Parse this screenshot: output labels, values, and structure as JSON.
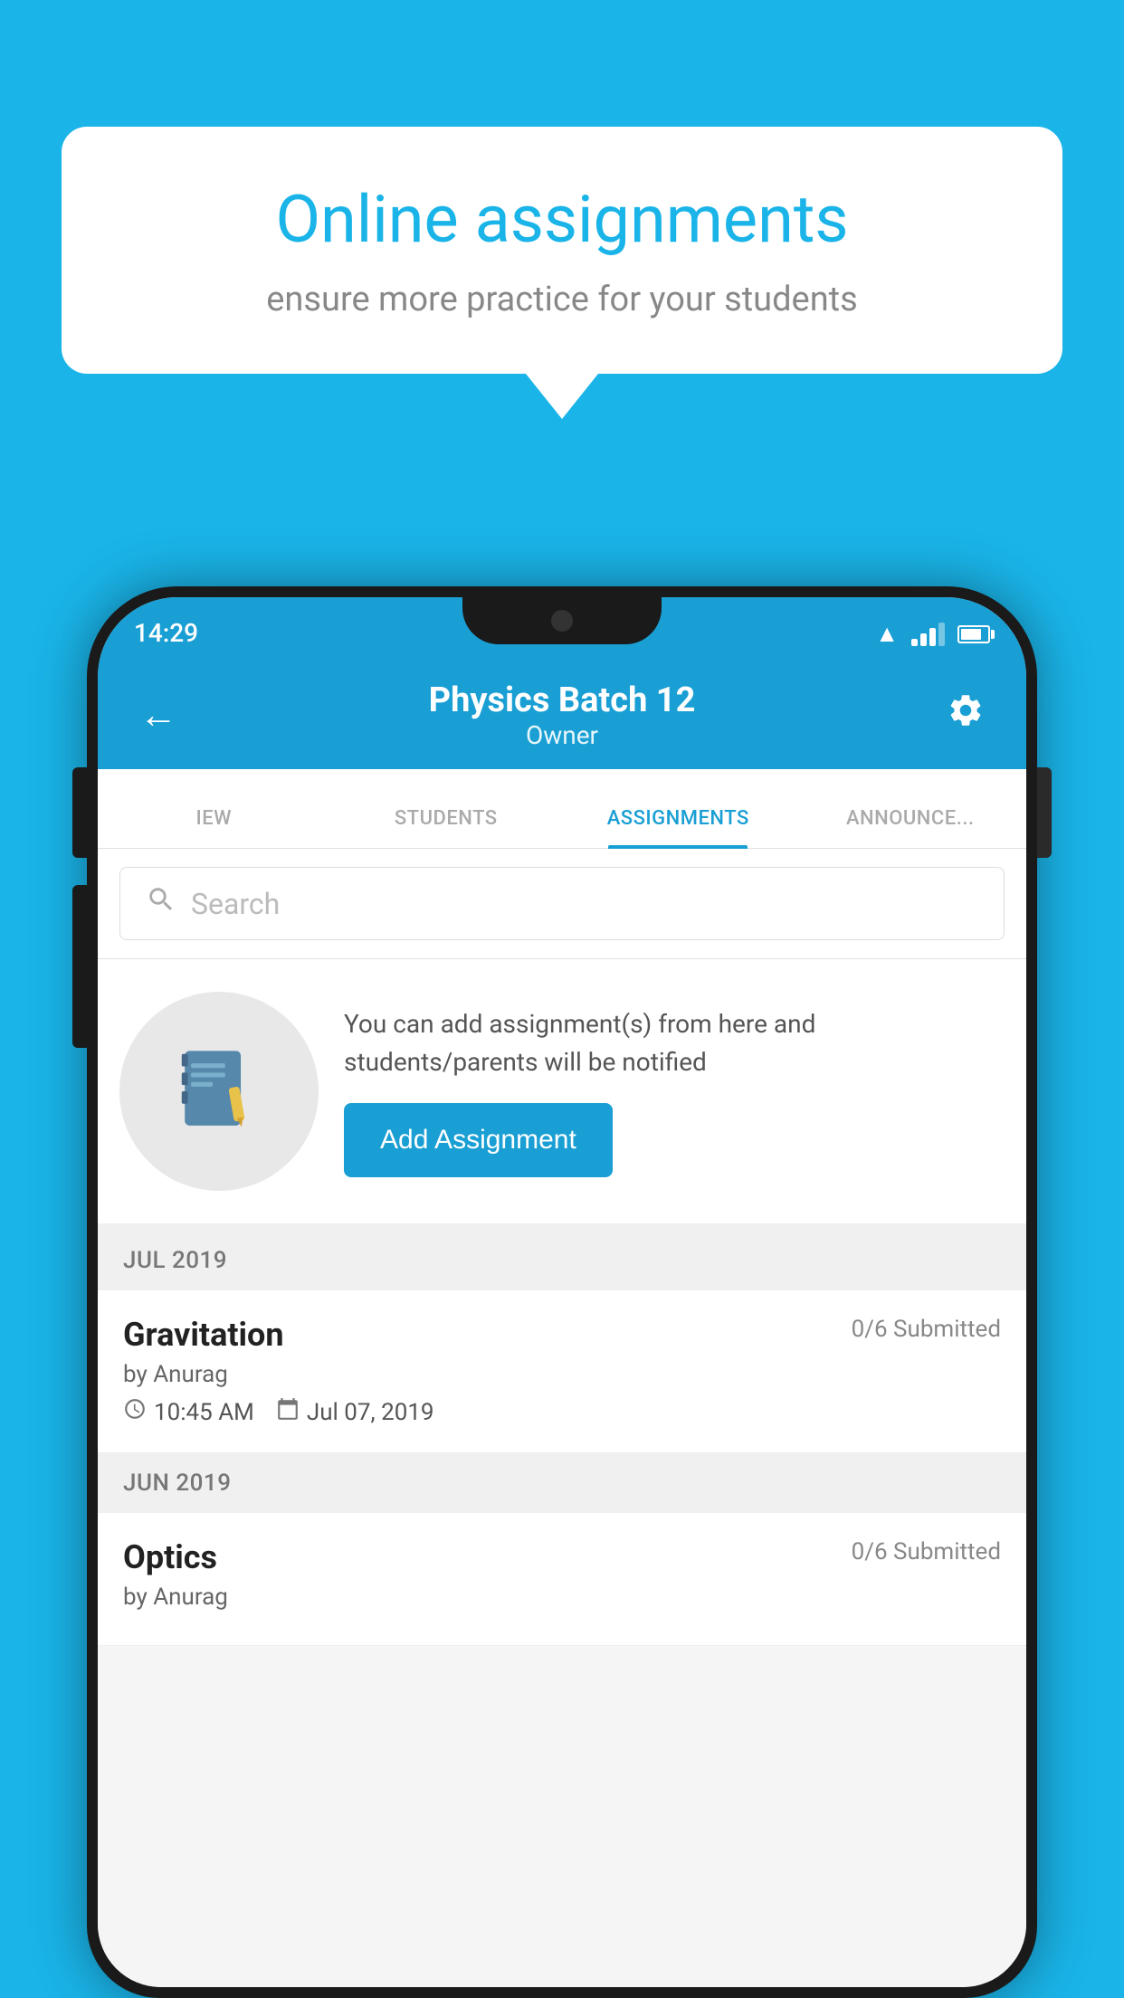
{
  "background_color": "#1ab4e8",
  "speech_bubble": {
    "title": "Online assignments",
    "subtitle": "ensure more practice for your students"
  },
  "phone": {
    "status_bar": {
      "time": "14:29"
    },
    "header": {
      "title": "Physics Batch 12",
      "subtitle": "Owner",
      "back_label": "←",
      "settings_label": "⚙"
    },
    "tabs": [
      {
        "label": "IEW",
        "active": false
      },
      {
        "label": "STUDENTS",
        "active": false
      },
      {
        "label": "ASSIGNMENTS",
        "active": true
      },
      {
        "label": "ANNOUNCEMENTS",
        "active": false
      }
    ],
    "search": {
      "placeholder": "Search"
    },
    "promo_card": {
      "description": "You can add assignment(s) from here and students/parents will be notified",
      "button_label": "Add Assignment"
    },
    "assignments": [
      {
        "month_label": "JUL 2019",
        "items": [
          {
            "name": "Gravitation",
            "submitted": "0/6 Submitted",
            "by": "by Anurag",
            "time": "10:45 AM",
            "date": "Jul 07, 2019"
          }
        ]
      },
      {
        "month_label": "JUN 2019",
        "items": [
          {
            "name": "Optics",
            "submitted": "0/6 Submitted",
            "by": "by Anurag",
            "time": "",
            "date": ""
          }
        ]
      }
    ]
  }
}
